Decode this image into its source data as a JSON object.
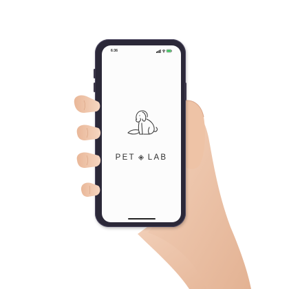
{
  "status_bar": {
    "time": "6:36",
    "icons": [
      "signal-icon",
      "wifi-icon",
      "battery-icon"
    ],
    "battery_color": "#34c759"
  },
  "splash": {
    "logo_icon": "dog-line-art-icon",
    "brand_left": "PET",
    "brand_separator_icon": "diamond-icon",
    "brand_right": "LAB"
  },
  "colors": {
    "phone_frame": "#2b2838",
    "screen_bg": "#fcfcfc",
    "brand_text": "#2f2f2f",
    "skin": "#f0c8ae"
  }
}
